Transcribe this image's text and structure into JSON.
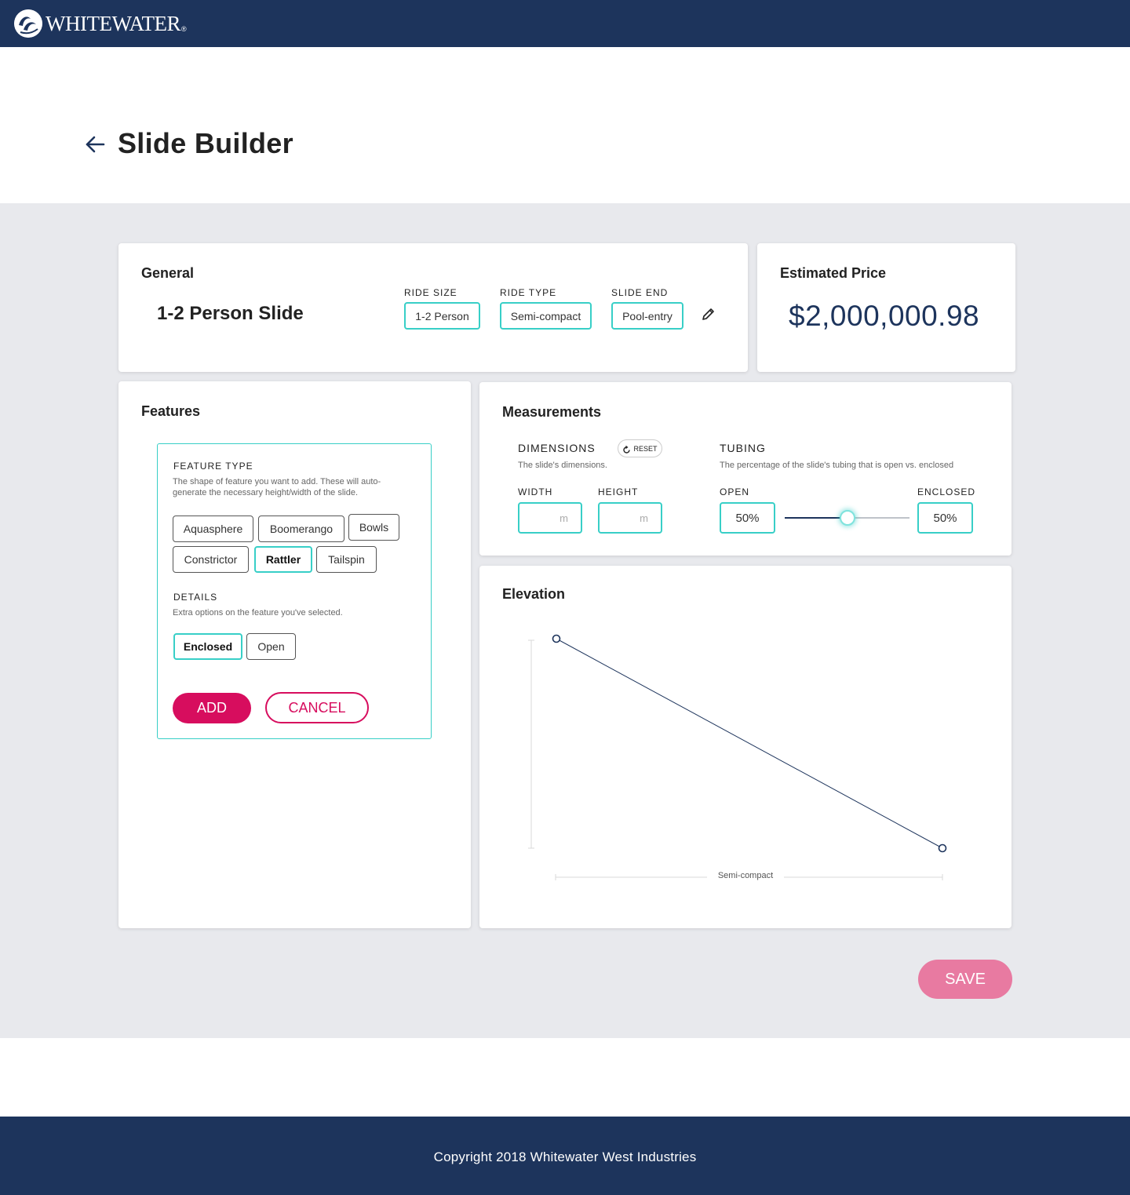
{
  "header": {
    "brand": "WHITEWATER",
    "brand_reg": "®"
  },
  "page": {
    "title": "Slide Builder"
  },
  "general": {
    "title": "General",
    "slide_name": "1-2 Person Slide",
    "ride_size_label": "RIDE SIZE",
    "ride_size_value": "1-2 Person",
    "ride_type_label": "RIDE TYPE",
    "ride_type_value": "Semi-compact",
    "slide_end_label": "SLIDE END",
    "slide_end_value": "Pool-entry"
  },
  "price": {
    "title": "Estimated Price",
    "value": "$2,000,000.98"
  },
  "features": {
    "title": "Features",
    "feature_type_label": "FEATURE TYPE",
    "feature_type_desc_1": "The shape of feature you want to add. These will auto-",
    "feature_type_desc_2": "generate the necessary height/width of the slide.",
    "options": [
      "Aquasphere",
      "Boomerango",
      "Bowls",
      "Constrictor",
      "Rattler",
      "Tailspin"
    ],
    "selected_option": "Rattler",
    "details_label": "DETAILS",
    "details_desc": "Extra options on the feature you've selected.",
    "details_options": [
      "Enclosed",
      "Open"
    ],
    "selected_detail": "Enclosed",
    "add_label": "ADD",
    "cancel_label": "CANCEL"
  },
  "measurements": {
    "title": "Measurements",
    "dimensions_label": "DIMENSIONS",
    "reset_label": "RESET",
    "dimensions_desc": "The slide's dimensions.",
    "width_label": "WIDTH",
    "height_label": "HEIGHT",
    "width_value": "",
    "height_value": "",
    "unit": "m",
    "tubing_label": "TUBING",
    "tubing_desc": "The percentage of the slide's tubing that is open vs. enclosed",
    "open_label": "OPEN",
    "enclosed_label": "ENCLOSED",
    "open_value": "50%",
    "enclosed_value": "50%",
    "slider_fraction": 0.5
  },
  "elevation": {
    "title": "Elevation",
    "x_axis_label": "Semi-compact"
  },
  "actions": {
    "save_label": "SAVE"
  },
  "footer": {
    "copyright": "Copyright 2018 Whitewater West Industries"
  },
  "colors": {
    "navy": "#1d345c",
    "teal": "#38cfc7",
    "magenta": "#d70d5e",
    "save_pink": "#e87aa1",
    "background": "#e8e9ed"
  }
}
